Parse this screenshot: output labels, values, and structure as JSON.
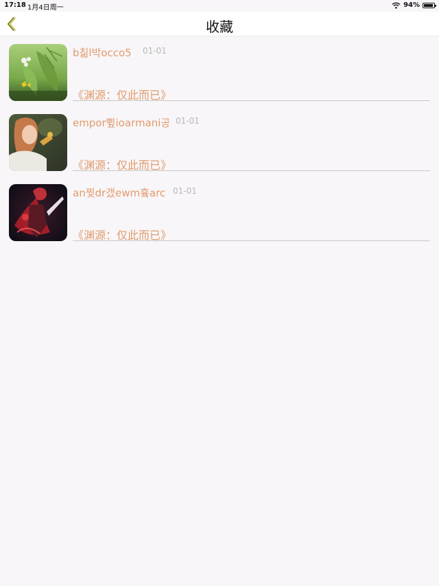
{
  "status_bar": {
    "time": "17:18",
    "date": "1月4日周一",
    "battery": "94%",
    "battery_level": 0.94,
    "wifi_icon": "wifi-icon"
  },
  "nav": {
    "back_icon": "chevron-left-icon",
    "title": "收藏"
  },
  "colors": {
    "accent": "#e09b6d",
    "back_icon": "#8a8a1a",
    "date": "#b9b9b9",
    "background": "#f8f6f8"
  },
  "favorites": [
    {
      "name": "b칢l박occo5",
      "date": "01-01",
      "subtitle": "《渊源：仅此而已》",
      "thumbnail": "leaf-butterfly-photo"
    },
    {
      "name": "empor쀺ioarmani공",
      "date": "01-01",
      "subtitle": "《渊源：仅此而已》",
      "thumbnail": "woman-portrait-photo"
    },
    {
      "name": "an찢dr갰ewm흌arc",
      "date": "01-01",
      "subtitle": "《渊源：仅此而已》",
      "thumbnail": "game-character-art"
    }
  ]
}
